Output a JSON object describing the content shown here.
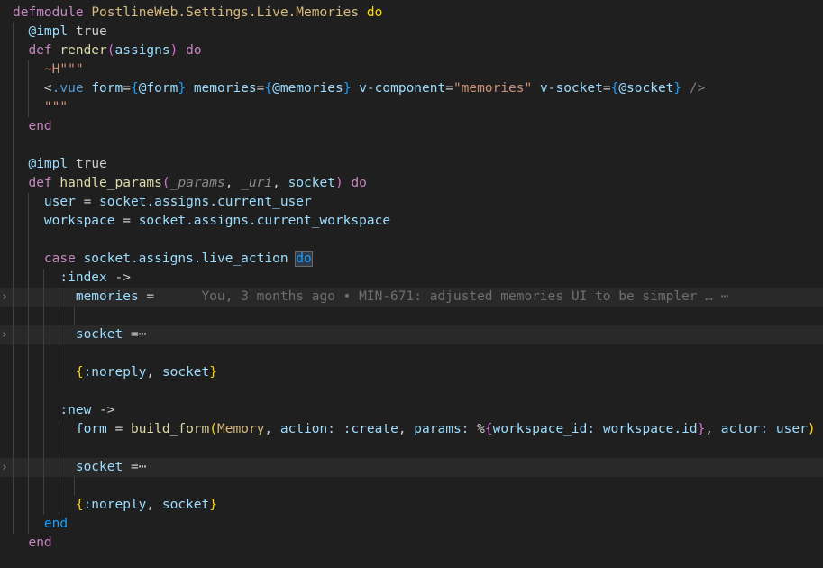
{
  "editor": {
    "lines": [
      {
        "segments": [
          [
            "kw",
            "defmodule "
          ],
          [
            "mod2",
            "PostlineWeb.Settings.Live.Memories "
          ],
          [
            "brY",
            "do"
          ]
        ]
      },
      {
        "segments": [
          [
            "pun",
            "  "
          ],
          [
            "at",
            "@impl "
          ],
          [
            "pun",
            "true"
          ]
        ]
      },
      {
        "segments": [
          [
            "pun",
            "  "
          ],
          [
            "kw",
            "def "
          ],
          [
            "fn",
            "render"
          ],
          [
            "brP",
            "("
          ],
          [
            "var",
            "assigns"
          ],
          [
            "brP",
            ")"
          ],
          [
            "kw",
            " do"
          ]
        ]
      },
      {
        "segments": [
          [
            "pun",
            "    "
          ],
          [
            "str",
            "~H\"\"\""
          ]
        ]
      },
      {
        "segments": [
          [
            "pun",
            "    "
          ],
          [
            "pun",
            "<"
          ],
          [
            "tag",
            ".vue "
          ],
          [
            "attr",
            "form"
          ],
          [
            "pun",
            "="
          ],
          [
            "brB",
            "{"
          ],
          [
            "var",
            "@form"
          ],
          [
            "brB",
            "}"
          ],
          [
            "pun",
            " "
          ],
          [
            "attr",
            "memories"
          ],
          [
            "pun",
            "="
          ],
          [
            "brB",
            "{"
          ],
          [
            "var",
            "@memories"
          ],
          [
            "brB",
            "}"
          ],
          [
            "pun",
            " "
          ],
          [
            "attr",
            "v-component"
          ],
          [
            "pun",
            "="
          ],
          [
            "strQ",
            "\"memories\""
          ],
          [
            "pun",
            " "
          ],
          [
            "attr",
            "v-socket"
          ],
          [
            "pun",
            "="
          ],
          [
            "brB",
            "{"
          ],
          [
            "var",
            "@socket"
          ],
          [
            "brB",
            "}"
          ],
          [
            "ph",
            " />"
          ]
        ]
      },
      {
        "segments": [
          [
            "pun",
            "    "
          ],
          [
            "str",
            "\"\"\""
          ]
        ]
      },
      {
        "segments": [
          [
            "pun",
            "  "
          ],
          [
            "kw",
            "end"
          ]
        ]
      },
      {
        "segments": [
          [
            "pun",
            ""
          ]
        ]
      },
      {
        "segments": [
          [
            "pun",
            "  "
          ],
          [
            "at",
            "@impl "
          ],
          [
            "pun",
            "true"
          ]
        ]
      },
      {
        "segments": [
          [
            "pun",
            "  "
          ],
          [
            "kw",
            "def "
          ],
          [
            "fn",
            "handle_params"
          ],
          [
            "brP",
            "("
          ],
          [
            "ital",
            "_params"
          ],
          [
            "pun",
            ", "
          ],
          [
            "ital",
            "_uri"
          ],
          [
            "pun",
            ", "
          ],
          [
            "var",
            "socket"
          ],
          [
            "brP",
            ")"
          ],
          [
            "kw",
            " do"
          ]
        ]
      },
      {
        "segments": [
          [
            "pun",
            "    "
          ],
          [
            "var",
            "user"
          ],
          [
            "pun",
            " = "
          ],
          [
            "var",
            "socket.assigns.current_user"
          ]
        ]
      },
      {
        "segments": [
          [
            "pun",
            "    "
          ],
          [
            "var",
            "workspace"
          ],
          [
            "pun",
            " = "
          ],
          [
            "var",
            "socket.assigns.current_workspace"
          ]
        ]
      },
      {
        "segments": [
          [
            "pun",
            ""
          ]
        ]
      },
      {
        "segments": [
          [
            "pun",
            "    "
          ],
          [
            "kw",
            "case "
          ],
          [
            "var",
            "socket.assigns.live_action "
          ],
          [
            "brB",
            "do"
          ]
        ]
      },
      {
        "segments": [
          [
            "pun",
            "      "
          ],
          [
            "atom",
            ":index"
          ],
          [
            "pun",
            " ->"
          ]
        ]
      },
      {
        "segments": [
          [
            "pun",
            "        "
          ],
          [
            "var",
            "memories"
          ],
          [
            "pun",
            " = "
          ],
          [
            "cmt",
            "     You, 3 months ago • MIN-671: adjusted memories UI to be simpler … ⋯"
          ]
        ]
      },
      {
        "segments": [
          [
            "pun",
            ""
          ]
        ]
      },
      {
        "segments": [
          [
            "pun",
            "        "
          ],
          [
            "var",
            "socket"
          ],
          [
            "pun",
            " =⋯"
          ]
        ]
      },
      {
        "segments": [
          [
            "pun",
            ""
          ]
        ]
      },
      {
        "segments": [
          [
            "pun",
            "        "
          ],
          [
            "brY",
            "{"
          ],
          [
            "atom",
            ":noreply"
          ],
          [
            "pun",
            ", "
          ],
          [
            "var",
            "socket"
          ],
          [
            "brY",
            "}"
          ]
        ]
      },
      {
        "segments": [
          [
            "pun",
            ""
          ]
        ]
      },
      {
        "segments": [
          [
            "pun",
            "      "
          ],
          [
            "atom",
            ":new"
          ],
          [
            "pun",
            " ->"
          ]
        ]
      },
      {
        "segments": [
          [
            "pun",
            "        "
          ],
          [
            "var",
            "form"
          ],
          [
            "pun",
            " = "
          ],
          [
            "fn",
            "build_form"
          ],
          [
            "brY",
            "("
          ],
          [
            "mod2",
            "Memory"
          ],
          [
            "pun",
            ", "
          ],
          [
            "key",
            "action: "
          ],
          [
            "atom",
            ":create"
          ],
          [
            "pun",
            ", "
          ],
          [
            "key",
            "params: "
          ],
          [
            "pun",
            "%"
          ],
          [
            "brP",
            "{"
          ],
          [
            "key",
            "workspace_id: "
          ],
          [
            "var",
            "workspace.id"
          ],
          [
            "brP",
            "}"
          ],
          [
            "pun",
            ", "
          ],
          [
            "key",
            "actor: "
          ],
          [
            "var",
            "user"
          ],
          [
            "brY",
            ")"
          ]
        ]
      },
      {
        "segments": [
          [
            "pun",
            ""
          ]
        ]
      },
      {
        "segments": [
          [
            "pun",
            "        "
          ],
          [
            "var",
            "socket"
          ],
          [
            "pun",
            " =⋯"
          ]
        ]
      },
      {
        "segments": [
          [
            "pun",
            ""
          ]
        ]
      },
      {
        "segments": [
          [
            "pun",
            "        "
          ],
          [
            "brY",
            "{"
          ],
          [
            "atom",
            ":noreply"
          ],
          [
            "pun",
            ", "
          ],
          [
            "var",
            "socket"
          ],
          [
            "brY",
            "}"
          ]
        ]
      },
      {
        "segments": [
          [
            "pun",
            "    "
          ],
          [
            "endB",
            "end"
          ]
        ]
      },
      {
        "segments": [
          [
            "pun",
            "  "
          ],
          [
            "kw",
            "end"
          ]
        ]
      }
    ],
    "fold_marker": "›",
    "highlighted_lines": [
      15,
      17,
      24
    ],
    "folded_lines": [
      15,
      17,
      24
    ]
  }
}
